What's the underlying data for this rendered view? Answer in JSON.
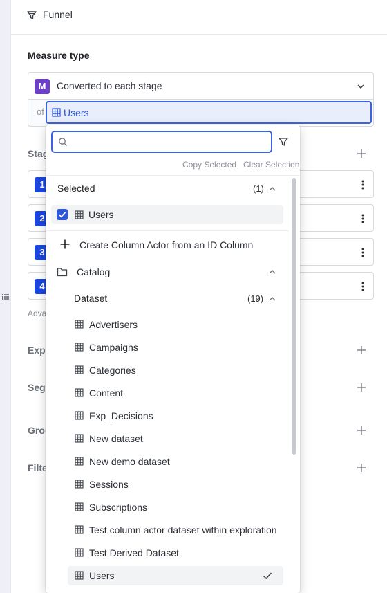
{
  "header": {
    "title": "Funnel"
  },
  "measure": {
    "label": "Measure type",
    "badge": "M",
    "value": "Converted to each stage",
    "of_label": "of",
    "actor_value": "Users"
  },
  "background": {
    "stages_label": "Stag",
    "stage_numbers": [
      "1",
      "2",
      "3",
      "4"
    ],
    "advanced_label": "Adva",
    "sections": [
      "Expe",
      "Segn",
      "Grou",
      "Filte"
    ]
  },
  "dropdown": {
    "search_placeholder": "",
    "copy_selected": "Copy Selected",
    "clear_selection": "Clear Selection",
    "selected_section": {
      "label": "Selected",
      "count": "(1)"
    },
    "selected_items": [
      "Users"
    ],
    "create_label": "Create Column Actor from an ID Column",
    "catalog_label": "Catalog",
    "dataset_section": {
      "label": "Dataset",
      "count": "(19)"
    },
    "datasets": [
      "Advertisers",
      "Campaigns",
      "Categories",
      "Content",
      "Exp_Decisions",
      "New dataset",
      "New demo dataset",
      "Sessions",
      "Subscriptions",
      "Test column actor dataset within exploration",
      "Test Derived Dataset",
      "Users"
    ],
    "active_dataset": "Users"
  },
  "colors": {
    "accent": "#3d63e0",
    "measure_badge": "#6b3fc8",
    "stage_badge": "#1b46e0"
  }
}
